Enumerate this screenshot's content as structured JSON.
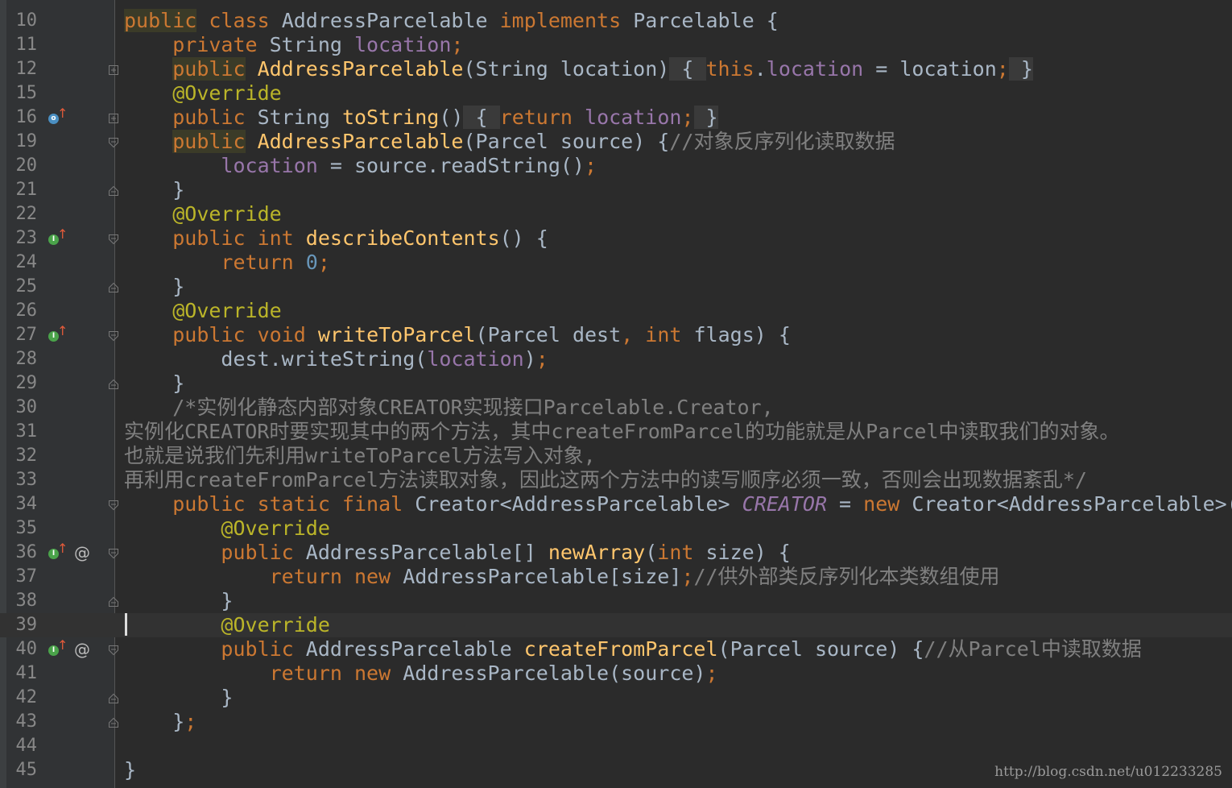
{
  "editor": {
    "lines": [
      {
        "n": "10",
        "tokens": [
          [
            "kw pub-hl",
            "public"
          ],
          [
            "",
            " "
          ],
          [
            "kw",
            "class"
          ],
          [
            "cls",
            " AddressParcelable "
          ],
          [
            "kw",
            "implements"
          ],
          [
            "cls",
            " Parcelable {"
          ]
        ]
      },
      {
        "n": "11",
        "tokens": [
          [
            "",
            "    "
          ],
          [
            "kw",
            "private"
          ],
          [
            "cls",
            " String "
          ],
          [
            "fld",
            "location"
          ],
          [
            "kw",
            ";"
          ]
        ]
      },
      {
        "n": "12",
        "fold": "plus",
        "tokens": [
          [
            "",
            "    "
          ],
          [
            "kw pub-hl",
            "public"
          ],
          [
            "fn",
            " AddressParcelable"
          ],
          [
            "cls",
            "(String location)"
          ],
          [
            "fold-hl",
            " { "
          ],
          [
            "kw",
            "this"
          ],
          [
            "cls",
            "."
          ],
          [
            "fld",
            "location"
          ],
          [
            "cls",
            " = location"
          ],
          [
            "kw",
            ";"
          ],
          [
            "fold-hl",
            " }"
          ]
        ]
      },
      {
        "n": "15",
        "tokens": [
          [
            "",
            "    "
          ],
          [
            "ann",
            "@Override"
          ]
        ]
      },
      {
        "n": "16",
        "marker": "o",
        "fold": "plus",
        "tokens": [
          [
            "",
            "    "
          ],
          [
            "kw",
            "public"
          ],
          [
            "cls",
            " String "
          ],
          [
            "fn",
            "toString"
          ],
          [
            "cls",
            "()"
          ],
          [
            "fold-hl",
            " { "
          ],
          [
            "kw",
            "return"
          ],
          [
            "cls",
            " "
          ],
          [
            "fld",
            "location"
          ],
          [
            "kw",
            ";"
          ],
          [
            "fold-hl",
            " }"
          ]
        ]
      },
      {
        "n": "19",
        "fold": "open",
        "tokens": [
          [
            "",
            "    "
          ],
          [
            "kw pub-hl",
            "public"
          ],
          [
            "fn",
            " AddressParcelable"
          ],
          [
            "cls",
            "(Parcel source) {"
          ],
          [
            "cmt",
            "//对象反序列化读取数据"
          ]
        ]
      },
      {
        "n": "20",
        "tokens": [
          [
            "",
            "        "
          ],
          [
            "fld",
            "location"
          ],
          [
            "cls",
            " = source.readString()"
          ],
          [
            "kw",
            ";"
          ]
        ]
      },
      {
        "n": "21",
        "fold": "close",
        "tokens": [
          [
            "",
            "    "
          ],
          [
            "cls",
            "}"
          ]
        ]
      },
      {
        "n": "22",
        "tokens": [
          [
            "",
            "    "
          ],
          [
            "ann",
            "@Override"
          ]
        ]
      },
      {
        "n": "23",
        "marker": "i",
        "fold": "open",
        "tokens": [
          [
            "",
            "    "
          ],
          [
            "kw",
            "public int"
          ],
          [
            "cls",
            " "
          ],
          [
            "fn",
            "describeContents"
          ],
          [
            "cls",
            "() {"
          ]
        ]
      },
      {
        "n": "24",
        "tokens": [
          [
            "",
            "        "
          ],
          [
            "kw",
            "return"
          ],
          [
            "cls",
            " "
          ],
          [
            "num",
            "0"
          ],
          [
            "kw",
            ";"
          ]
        ]
      },
      {
        "n": "25",
        "fold": "close",
        "tokens": [
          [
            "",
            "    "
          ],
          [
            "cls",
            "}"
          ]
        ]
      },
      {
        "n": "26",
        "tokens": [
          [
            "",
            "    "
          ],
          [
            "ann",
            "@Override"
          ]
        ]
      },
      {
        "n": "27",
        "marker": "i",
        "fold": "open",
        "tokens": [
          [
            "",
            "    "
          ],
          [
            "kw",
            "public void"
          ],
          [
            "cls",
            " "
          ],
          [
            "fn",
            "writeToParcel"
          ],
          [
            "cls",
            "(Parcel dest"
          ],
          [
            "kw",
            ","
          ],
          [
            "cls",
            " "
          ],
          [
            "kw",
            "int"
          ],
          [
            "cls",
            " flags) {"
          ]
        ]
      },
      {
        "n": "28",
        "tokens": [
          [
            "",
            "        "
          ],
          [
            "cls",
            "dest.writeString("
          ],
          [
            "fld",
            "location"
          ],
          [
            "cls",
            ")"
          ],
          [
            "kw",
            ";"
          ]
        ]
      },
      {
        "n": "29",
        "fold": "close",
        "tokens": [
          [
            "",
            "    "
          ],
          [
            "cls",
            "}"
          ]
        ]
      },
      {
        "n": "30",
        "tokens": [
          [
            "",
            "    "
          ],
          [
            "cmt",
            "/*实例化静态内部对象CREATOR实现接口Parcelable.Creator,"
          ]
        ]
      },
      {
        "n": "31",
        "tokens": [
          [
            "cmt",
            "实例化CREATOR时要实现其中的两个方法，其中createFromParcel的功能就是从Parcel中读取我们的对象。"
          ]
        ]
      },
      {
        "n": "32",
        "tokens": [
          [
            "cmt",
            "也就是说我们先利用writeToParcel方法写入对象,"
          ]
        ]
      },
      {
        "n": "33",
        "tokens": [
          [
            "cmt",
            "再利用createFromParcel方法读取对象，因此这两个方法中的读写顺序必须一致，否则会出现数据紊乱*/"
          ]
        ]
      },
      {
        "n": "34",
        "fold": "open",
        "tokens": [
          [
            "",
            "    "
          ],
          [
            "kw",
            "public static final"
          ],
          [
            "cls",
            " Creator<AddressParcelable> "
          ],
          [
            "cstf",
            "CREATOR"
          ],
          [
            "cls",
            " = "
          ],
          [
            "kw",
            "new"
          ],
          [
            "cls",
            " Creator<AddressParcelable>() {"
          ]
        ]
      },
      {
        "n": "35",
        "tokens": [
          [
            "",
            "        "
          ],
          [
            "ann",
            "@Override"
          ]
        ]
      },
      {
        "n": "36",
        "marker": "i",
        "at": "@",
        "fold": "open",
        "tokens": [
          [
            "",
            "        "
          ],
          [
            "kw",
            "public"
          ],
          [
            "cls",
            " AddressParcelable[] "
          ],
          [
            "fn",
            "newArray"
          ],
          [
            "cls",
            "("
          ],
          [
            "kw",
            "int"
          ],
          [
            "cls",
            " size) {"
          ]
        ]
      },
      {
        "n": "37",
        "tokens": [
          [
            "",
            "            "
          ],
          [
            "kw",
            "return new"
          ],
          [
            "cls",
            " AddressParcelable[size]"
          ],
          [
            "kw",
            ";"
          ],
          [
            "cmt",
            "//供外部类反序列化本类数组使用"
          ]
        ]
      },
      {
        "n": "38",
        "fold": "close",
        "tokens": [
          [
            "",
            "        "
          ],
          [
            "cls",
            "}"
          ]
        ]
      },
      {
        "n": "39",
        "current": true,
        "tokens": [
          [
            "",
            "        "
          ],
          [
            "ann",
            "@Override"
          ]
        ]
      },
      {
        "n": "40",
        "marker": "i",
        "at": "@",
        "fold": "open",
        "tokens": [
          [
            "",
            "        "
          ],
          [
            "kw",
            "public"
          ],
          [
            "cls",
            " AddressParcelable "
          ],
          [
            "fn",
            "createFromParcel"
          ],
          [
            "cls",
            "(Parcel source) {"
          ],
          [
            "cmt",
            "//从Parcel中读取数据"
          ]
        ]
      },
      {
        "n": "41",
        "tokens": [
          [
            "",
            "            "
          ],
          [
            "kw",
            "return new"
          ],
          [
            "cls",
            " AddressParcelable(source)"
          ],
          [
            "kw",
            ";"
          ]
        ]
      },
      {
        "n": "42",
        "fold": "close",
        "tokens": [
          [
            "",
            "        "
          ],
          [
            "cls",
            "}"
          ]
        ]
      },
      {
        "n": "43",
        "fold": "close",
        "tokens": [
          [
            "",
            "    "
          ],
          [
            "cls",
            "}"
          ],
          [
            "kw",
            ";"
          ]
        ]
      },
      {
        "n": "44",
        "tokens": []
      },
      {
        "n": "45",
        "tokens": [
          [
            "cls",
            "}"
          ]
        ]
      }
    ]
  },
  "watermark": "http://blog.csdn.net/u012233285",
  "colors": {
    "background": "#2b2b2b",
    "keyword": "#cc7832",
    "function": "#ffc66d",
    "field": "#9876aa",
    "annotation": "#bbb529",
    "number": "#6897bb",
    "comment": "#808080",
    "text": "#a9b7c6"
  }
}
